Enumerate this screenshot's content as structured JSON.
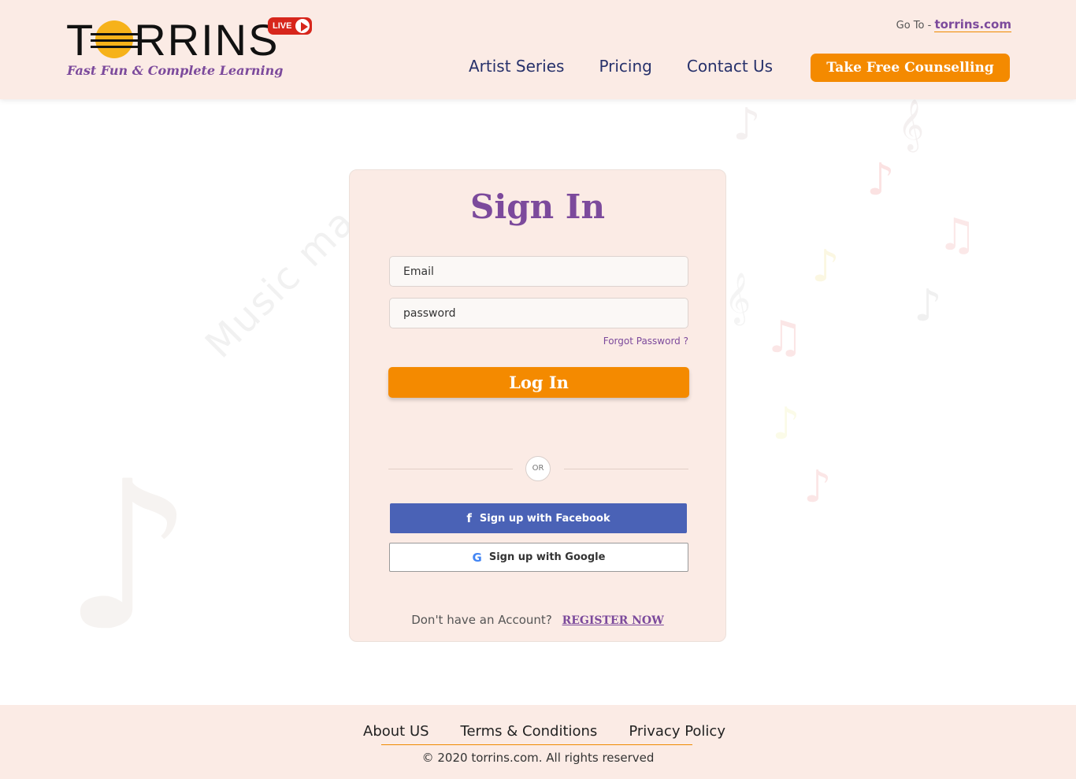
{
  "header": {
    "logo_text": "TORRINS",
    "tagline": "Fast Fun & Complete Learning",
    "live_badge": "LIVE",
    "goto_prefix": "Go To - ",
    "goto_link": "torrins.com",
    "nav": [
      "Artist Series",
      "Pricing",
      "Contact Us"
    ],
    "cta_label": "Take Free Counselling"
  },
  "background": {
    "watermark_text": "Music ma"
  },
  "signin": {
    "title": "Sign In",
    "email_placeholder": "Email",
    "password_placeholder": "password",
    "forgot_label": "Forgot Password ?",
    "login_label": "Log In",
    "or_label": "OR",
    "facebook_label": "Sign up with Facebook",
    "google_label": "Sign up with Google",
    "register_prompt": "Don't have an Account?",
    "register_label": "REGISTER NOW"
  },
  "footer": {
    "links": [
      "About US",
      "Terms & Conditions",
      "Privacy Policy"
    ],
    "copyright": "© 2020 torrins.com. All rights reserved"
  },
  "colors": {
    "accent_orange": "#f48a00",
    "brand_purple": "#7c4a9c",
    "nav_blue": "#27316b",
    "facebook_blue": "#4a62b6",
    "header_bg": "#fbebe5"
  }
}
